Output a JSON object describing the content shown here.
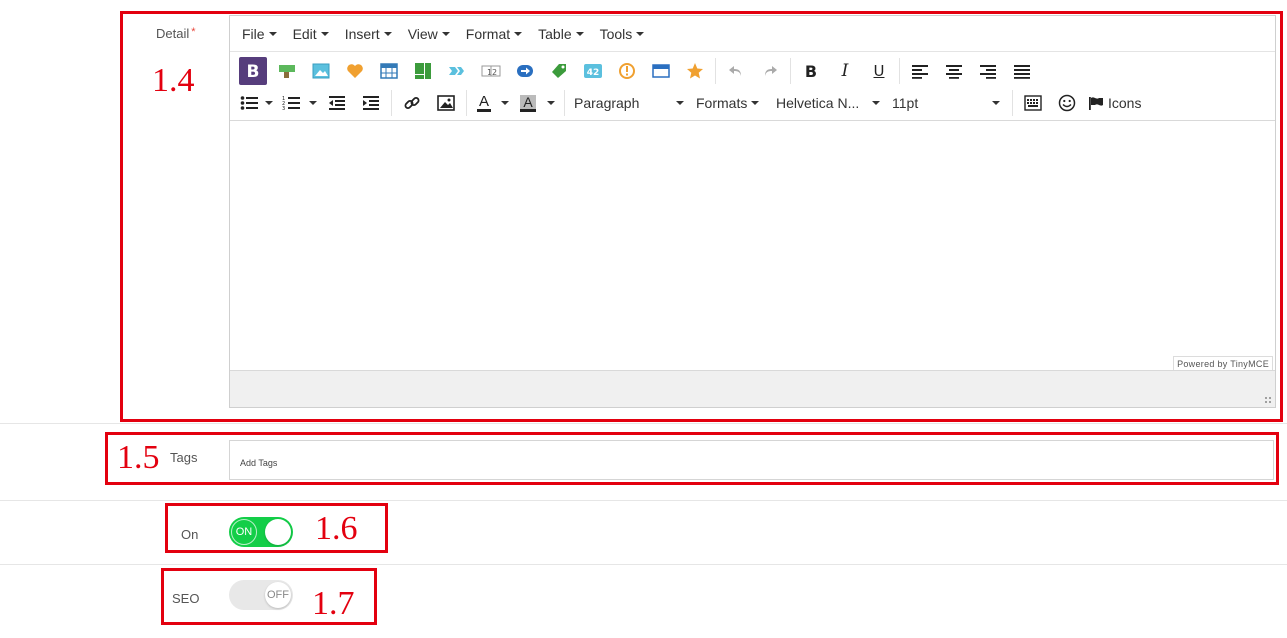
{
  "detail": {
    "label": "Detail",
    "required_mark": "*",
    "menubar": [
      {
        "label": "File"
      },
      {
        "label": "Edit"
      },
      {
        "label": "Insert"
      },
      {
        "label": "View"
      },
      {
        "label": "Format"
      },
      {
        "label": "Table"
      },
      {
        "label": "Tools"
      }
    ],
    "toolbar": {
      "block_format": "Paragraph",
      "formats": "Formats",
      "font_family": "Helvetica N...",
      "font_size": "11pt",
      "icons_label": "Icons",
      "bold_glyph": "B",
      "italic_glyph": "I",
      "underline_glyph": "U",
      "forecolor_glyph": "A",
      "backcolor_glyph": "A"
    },
    "powered_by": "Powered by TinyMCE"
  },
  "tags": {
    "label": "Tags",
    "placeholder": "Add Tags"
  },
  "status_switch": {
    "label": "On",
    "state_text": "ON",
    "checked": true,
    "color": "#13ce48"
  },
  "seo_switch": {
    "label": "SEO",
    "state_text": "OFF",
    "checked": false,
    "color": "#e8e8e8"
  },
  "annotations": {
    "detail": "1.4",
    "tags": "1.5",
    "status": "1.6",
    "seo": "1.7",
    "color": "#e3000f"
  }
}
